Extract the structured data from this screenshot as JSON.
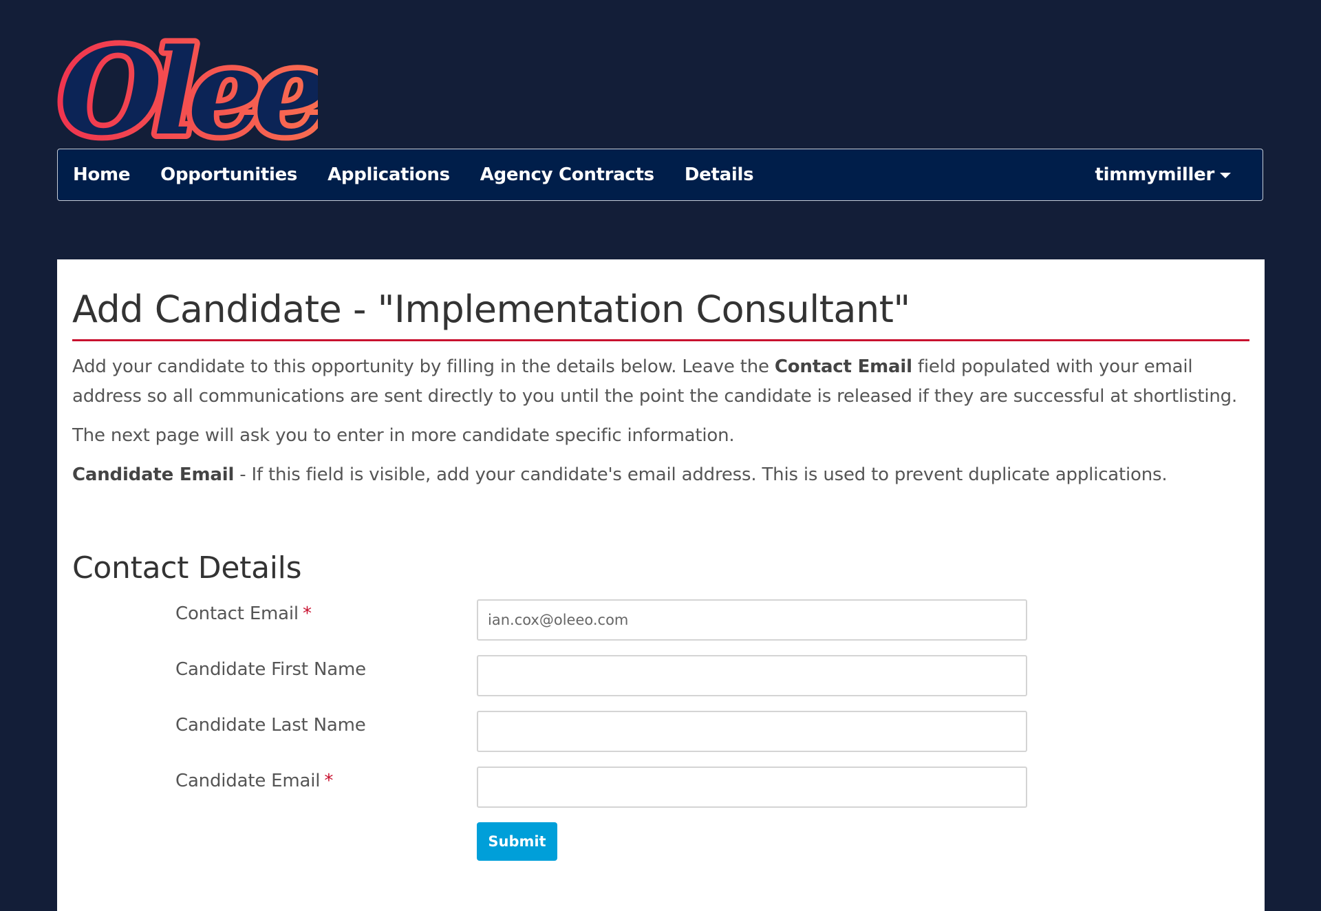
{
  "brand": {
    "logo_text": "Oleeo"
  },
  "nav": {
    "items": [
      {
        "label": "Home"
      },
      {
        "label": "Opportunities"
      },
      {
        "label": "Applications"
      },
      {
        "label": "Agency Contracts"
      },
      {
        "label": "Details"
      }
    ],
    "user": "timmymiller"
  },
  "main": {
    "title": "Add Candidate - \"Implementation Consultant\"",
    "intro": {
      "p1_before": "Add your candidate to this opportunity by filling in the details below. Leave the ",
      "p1_bold": "Contact Email",
      "p1_after": " field populated with your email address so all communications are sent directly to you until the point the candidate is released if they are successful at shortlisting.",
      "p2": "The next page will ask you to enter in more candidate specific information.",
      "p3_bold": "Candidate Email",
      "p3_after": " - If this field is visible, add your candidate's email address. This is used to prevent duplicate applications."
    },
    "section_title": "Contact Details",
    "form": {
      "contact_email": {
        "label": "Contact Email",
        "required_mark": "*",
        "value": "ian.cox@oleeo.com"
      },
      "first_name": {
        "label": "Candidate First Name",
        "value": ""
      },
      "last_name": {
        "label": "Candidate Last Name",
        "value": ""
      },
      "candidate_email": {
        "label": "Candidate Email",
        "required_mark": "*",
        "value": ""
      },
      "submit_label": "Submit"
    }
  },
  "colors": {
    "page_background": "#131e38",
    "nav_background": "#001e4a",
    "accent_red": "#c8102e",
    "submit_blue": "#009fd9",
    "logo_gradient_start": "#f0354f",
    "logo_gradient_end": "#fb7d52",
    "logo_inner": "#0c2456"
  }
}
